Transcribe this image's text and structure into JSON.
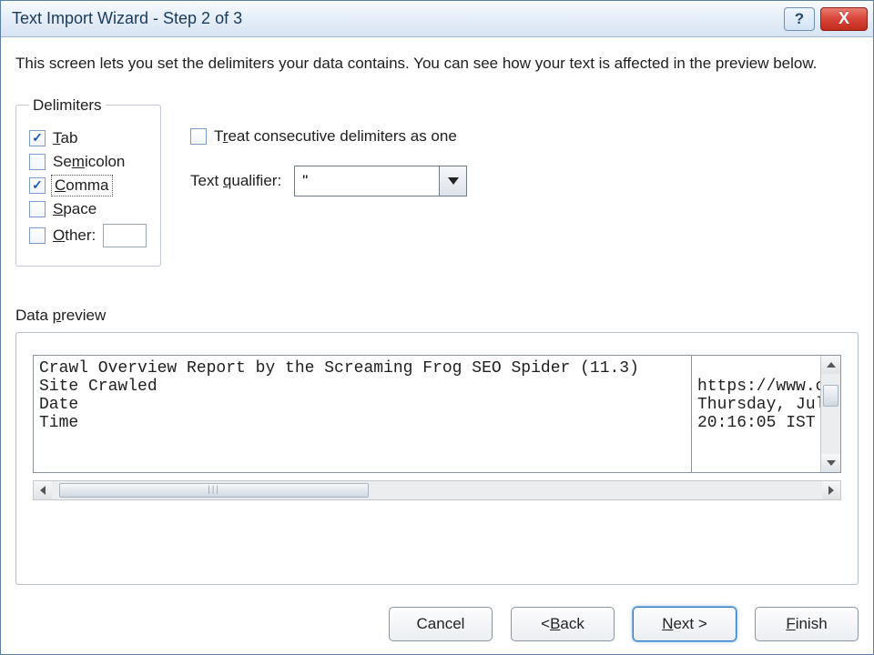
{
  "titlebar": {
    "title": "Text Import Wizard - Step 2 of 3",
    "help_tooltip": "?",
    "close_tooltip": "X"
  },
  "instruction": "This screen lets you set the delimiters your data contains.  You can see how your text is affected in the preview below.",
  "delimiters": {
    "legend": "Delimiters",
    "items": [
      {
        "label_pre": "",
        "mne": "T",
        "label_post": "ab",
        "checked": true,
        "focused": false
      },
      {
        "label_pre": "Se",
        "mne": "m",
        "label_post": "icolon",
        "checked": false,
        "focused": false
      },
      {
        "label_pre": "",
        "mne": "C",
        "label_post": "omma",
        "checked": true,
        "focused": true
      },
      {
        "label_pre": "",
        "mne": "S",
        "label_post": "pace",
        "checked": false,
        "focused": false
      },
      {
        "label_pre": "",
        "mne": "O",
        "label_post": "ther:",
        "checked": false,
        "focused": false
      }
    ]
  },
  "options": {
    "treat_consecutive": {
      "label_pre": "T",
      "mne": "r",
      "label_post": "eat consecutive delimiters as one",
      "checked": false
    },
    "text_qualifier": {
      "label_pre": "Text ",
      "mne": "q",
      "label_post": "ualifier:",
      "value": "\""
    }
  },
  "preview": {
    "label_pre": "Data ",
    "mne": "p",
    "label_post": "review",
    "col1": [
      "Crawl Overview Report by the Screaming Frog SEO Spider (11.3)",
      "Site Crawled",
      "Date",
      "Time"
    ],
    "col2": [
      "",
      "https://www.c",
      "Thursday, Jul",
      "20:16:05 IST"
    ]
  },
  "buttons": {
    "cancel": "Cancel",
    "back_pre": "< ",
    "back_mne": "B",
    "back_post": "ack",
    "next_mne": "N",
    "next_post": "ext >",
    "finish_mne": "F",
    "finish_post": "inish"
  }
}
